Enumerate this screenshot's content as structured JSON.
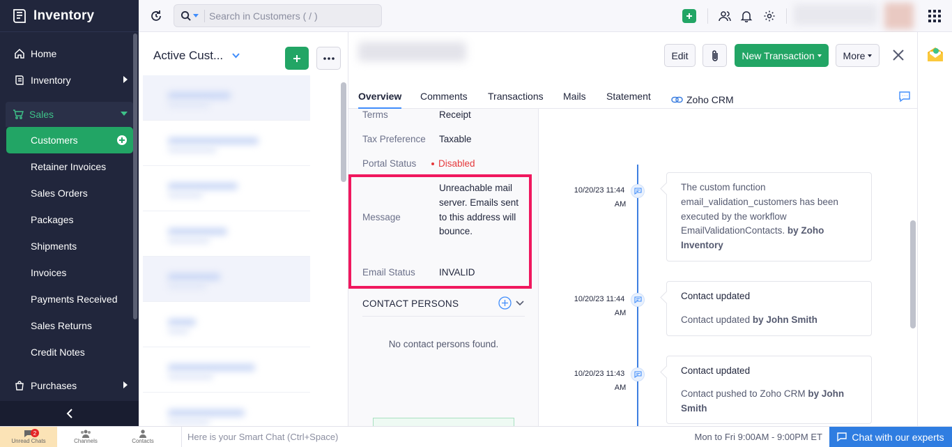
{
  "brand": {
    "title": "Inventory"
  },
  "sidebar": {
    "items": [
      {
        "label": "Home",
        "icon": "home-icon"
      },
      {
        "label": "Inventory",
        "icon": "inventory-icon"
      }
    ],
    "sales": {
      "label": "Sales",
      "subitems": [
        {
          "label": "Customers",
          "active": true
        },
        {
          "label": "Retainer Invoices"
        },
        {
          "label": "Sales Orders"
        },
        {
          "label": "Packages"
        },
        {
          "label": "Shipments"
        },
        {
          "label": "Invoices"
        },
        {
          "label": "Payments Received"
        },
        {
          "label": "Sales Returns"
        },
        {
          "label": "Credit Notes"
        }
      ]
    },
    "purchases": {
      "label": "Purchases"
    }
  },
  "search": {
    "placeholder": "Search in Customers ( / )"
  },
  "list": {
    "title": "Active Cust..."
  },
  "detail": {
    "buttons": {
      "edit": "Edit",
      "new_transaction": "New Transaction",
      "more": "More"
    },
    "tabs": [
      "Overview",
      "Comments",
      "Transactions",
      "Mails",
      "Statement",
      "Zoho CRM"
    ],
    "fields": {
      "terms_label": "Terms",
      "terms_value": "Receipt",
      "tax_label": "Tax Preference",
      "tax_value": "Taxable",
      "portal_label": "Portal Status",
      "portal_value": "Disabled",
      "message_label": "Message",
      "message_value": "Unreachable mail server. Emails sent to this address will bounce.",
      "email_status_label": "Email Status",
      "email_status_value": "INVALID"
    },
    "contact_persons": {
      "title": "CONTACT PERSONS",
      "empty": "No contact persons found."
    }
  },
  "timeline": [
    {
      "date": "10/20/23 11:44",
      "ampm": "AM",
      "text": "The custom function email_validation_customers has been executed by the workflow EmailValidationContacts.",
      "by": "by Zoho Inventory"
    },
    {
      "date": "10/20/23 11:44",
      "ampm": "AM",
      "title": "Contact updated",
      "text": "Contact updated",
      "by": "by John Smith"
    },
    {
      "date": "10/20/23 11:43",
      "ampm": "AM",
      "title": "Contact updated",
      "text": "Contact pushed to Zoho CRM",
      "by": "by John Smith"
    }
  ],
  "bottombar": {
    "unread_chats": "Unread Chats",
    "unread_count": "2",
    "channels": "Channels",
    "contacts": "Contacts",
    "smart_chat_placeholder": "Here is your Smart Chat (Ctrl+Space)",
    "hours": "Mon to Fri 9:00AM - 9:00PM ET",
    "expert": "Chat with our experts"
  },
  "colors": {
    "sidebar": "#21263c",
    "accent_green": "#22a565",
    "highlight": "#f0185e",
    "link_blue": "#408dfb"
  }
}
